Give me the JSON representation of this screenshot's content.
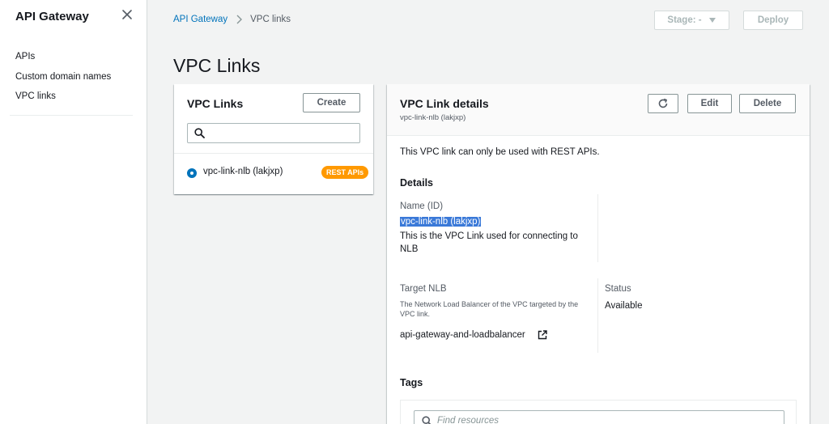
{
  "sidebar": {
    "title": "API Gateway",
    "items": [
      {
        "label": "APIs"
      },
      {
        "label": "Custom domain names"
      },
      {
        "label": "VPC links"
      }
    ]
  },
  "breadcrumb": {
    "root": "API Gateway",
    "current": "VPC links"
  },
  "toolbar": {
    "stage_label": "Stage: -",
    "deploy_label": "Deploy"
  },
  "page": {
    "title": "VPC Links"
  },
  "vpc_links_panel": {
    "title": "VPC Links",
    "create_label": "Create",
    "items": [
      {
        "label": "vpc-link-nlb (lakjxp)",
        "badge": "REST APIs",
        "selected": true
      }
    ]
  },
  "details_panel": {
    "title": "VPC Link details",
    "subtitle": "vpc-link-nlb (lakjxp)",
    "edit_label": "Edit",
    "delete_label": "Delete",
    "info": "This VPC link can only be used with REST APIs.",
    "details_heading": "Details",
    "name_label": "Name (ID)",
    "name_value": "vpc-link-nlb (lakjxp)",
    "description": "This is the VPC Link used for connecting to NLB",
    "target_label": "Target NLB",
    "target_desc": "The Network Load Balancer of the VPC targeted by the VPC link.",
    "target_value": "api-gateway-and-loadbalancer",
    "status_label": "Status",
    "status_value": "Available",
    "tags_heading": "Tags",
    "tags_search_placeholder": "Find resources"
  },
  "colors": {
    "link": "#0073bb",
    "badge": "#ff9900",
    "highlight": "#3a79d8"
  }
}
